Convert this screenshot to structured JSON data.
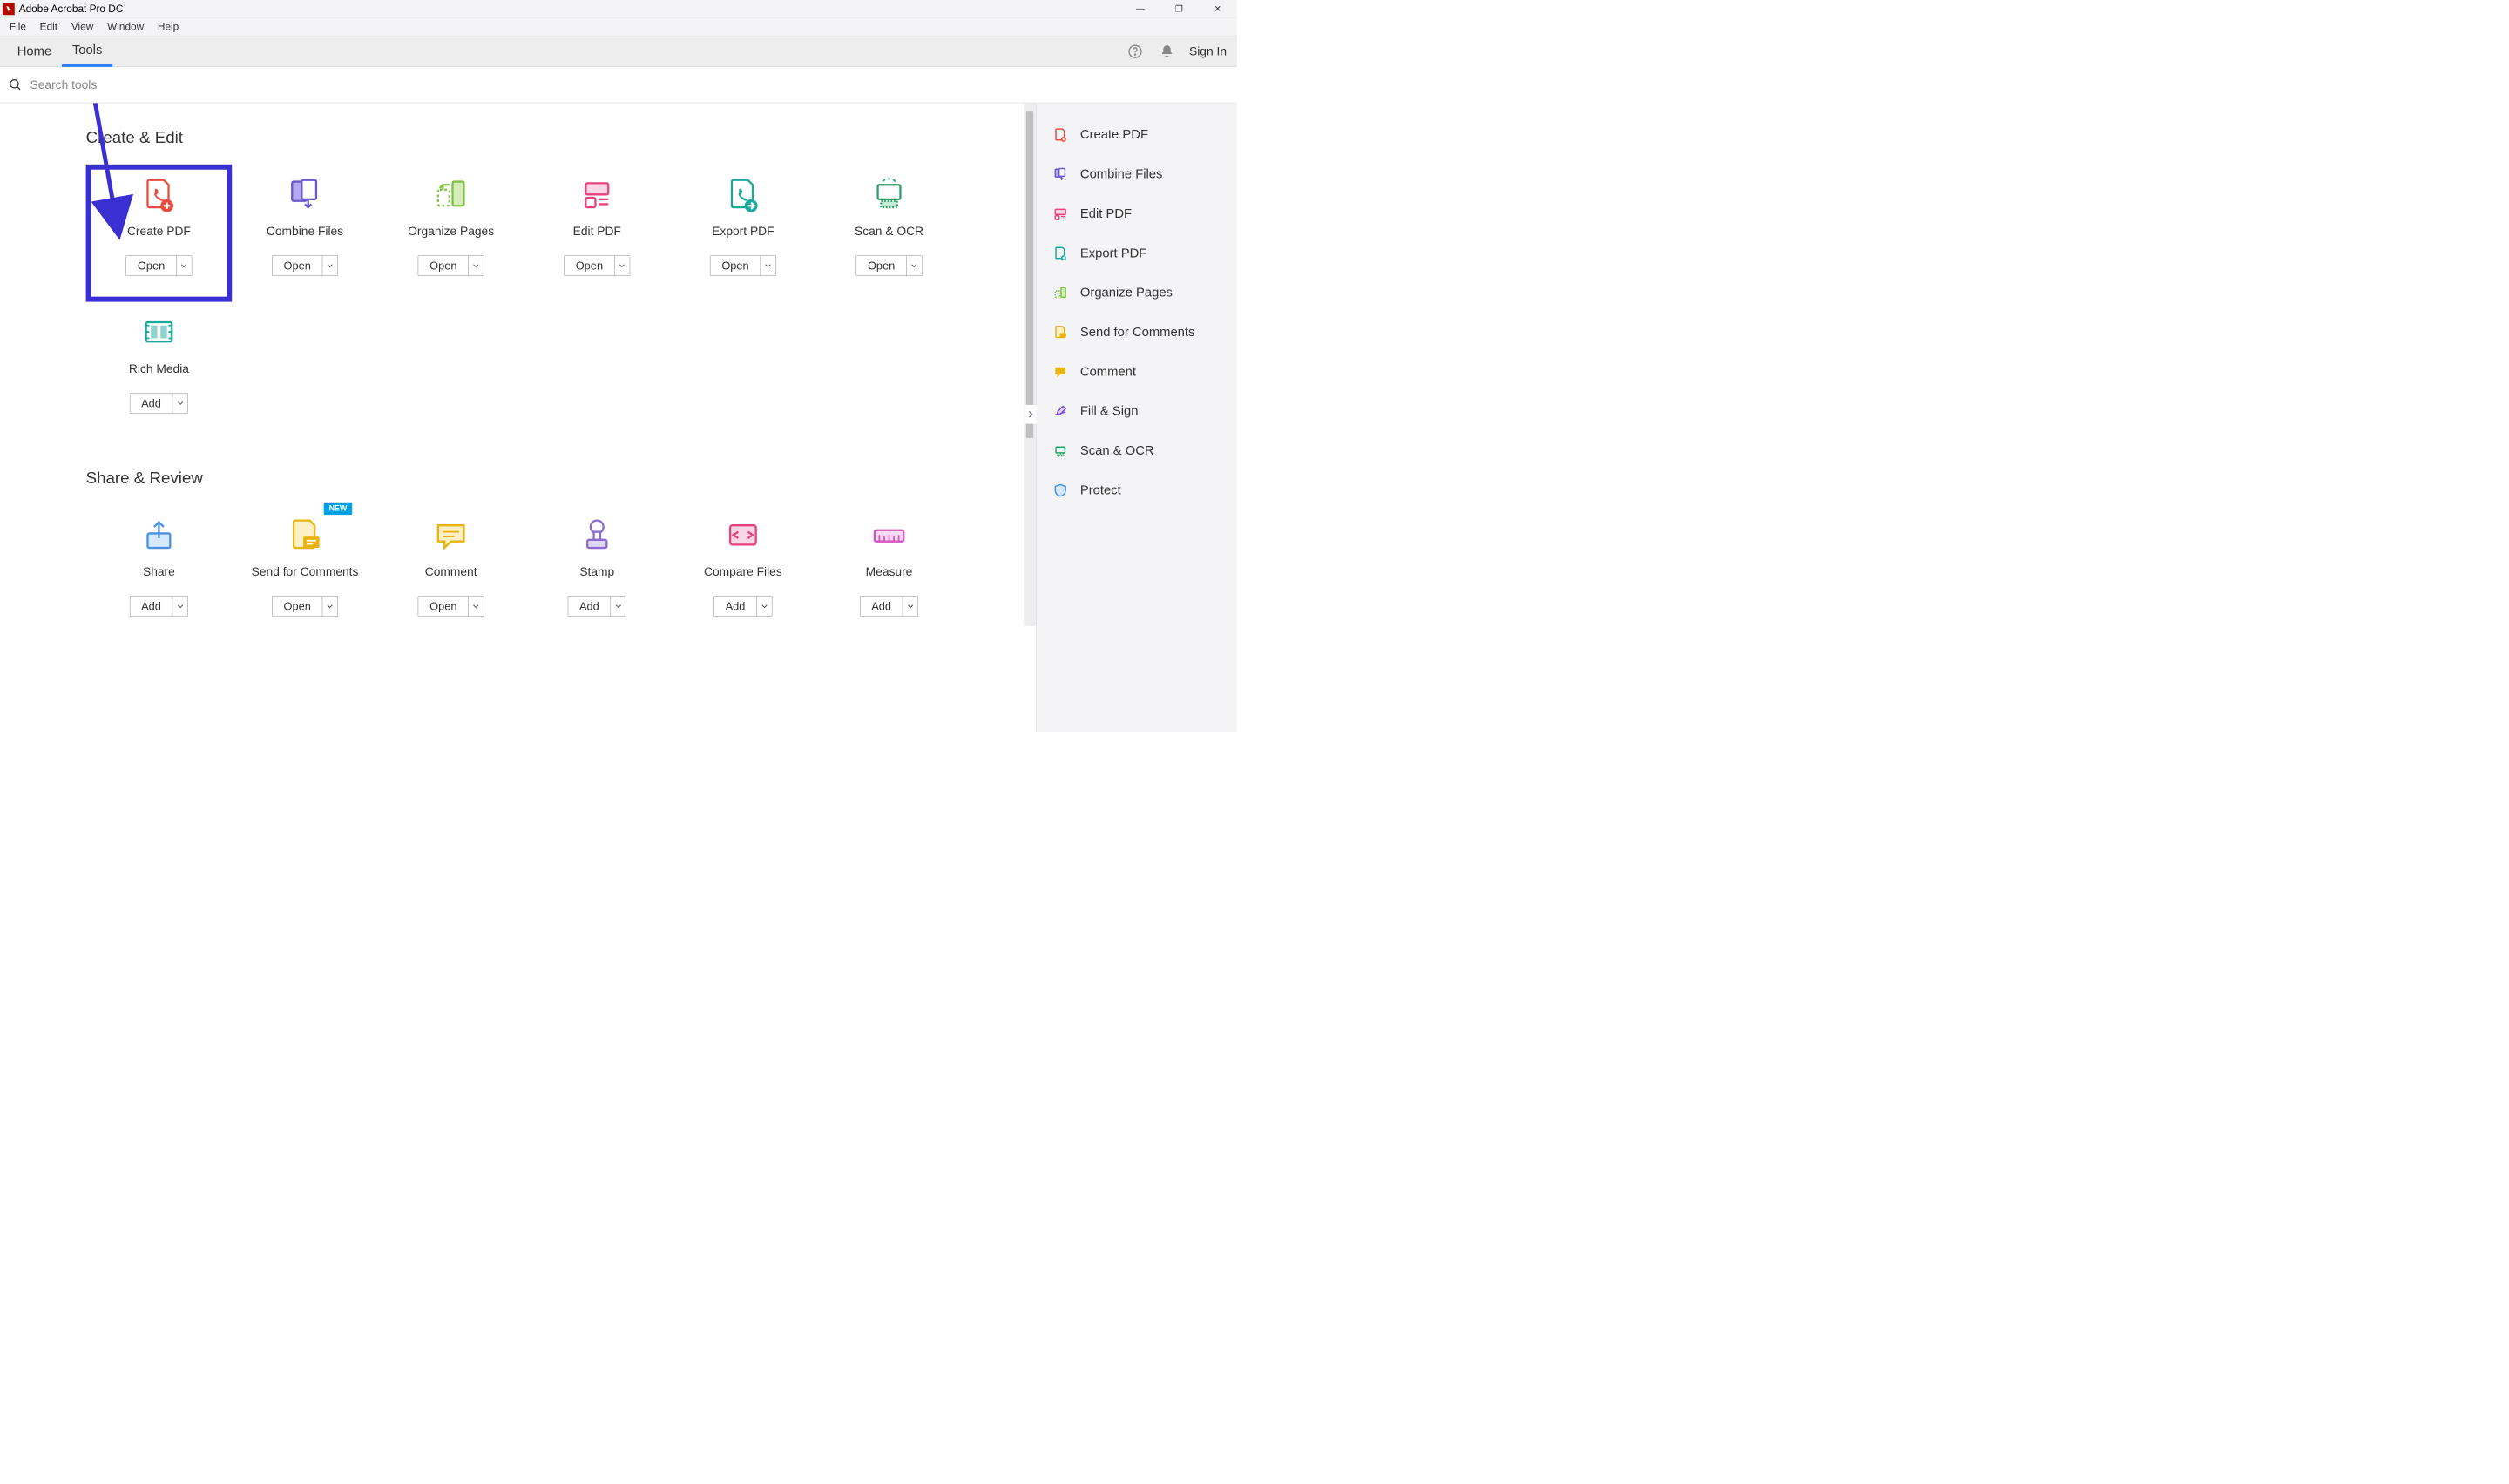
{
  "window": {
    "title": "Adobe Acrobat Pro DC",
    "minimize": "—",
    "maximize": "❐",
    "close": "✕"
  },
  "menubar": [
    "File",
    "Edit",
    "View",
    "Window",
    "Help"
  ],
  "tabbar": {
    "tabs": [
      "Home",
      "Tools"
    ],
    "active": 1,
    "signin": "Sign In"
  },
  "search": {
    "placeholder": "Search tools"
  },
  "sections": [
    {
      "title": "Create & Edit",
      "tools": [
        {
          "label": "Create PDF",
          "button": "Open",
          "icon": "create-pdf-icon",
          "highlighted": true
        },
        {
          "label": "Combine Files",
          "button": "Open",
          "icon": "combine-files-icon"
        },
        {
          "label": "Organize Pages",
          "button": "Open",
          "icon": "organize-pages-icon"
        },
        {
          "label": "Edit PDF",
          "button": "Open",
          "icon": "edit-pdf-icon"
        },
        {
          "label": "Export PDF",
          "button": "Open",
          "icon": "export-pdf-icon"
        },
        {
          "label": "Scan & OCR",
          "button": "Open",
          "icon": "scan-ocr-icon"
        },
        {
          "label": "Rich Media",
          "button": "Add",
          "icon": "rich-media-icon"
        }
      ]
    },
    {
      "title": "Share & Review",
      "tools": [
        {
          "label": "Share",
          "button": "Add",
          "icon": "share-icon"
        },
        {
          "label": "Send for Comments",
          "button": "Open",
          "icon": "send-comments-icon",
          "badge": "NEW"
        },
        {
          "label": "Comment",
          "button": "Open",
          "icon": "comment-icon"
        },
        {
          "label": "Stamp",
          "button": "Add",
          "icon": "stamp-icon"
        },
        {
          "label": "Compare Files",
          "button": "Add",
          "icon": "compare-files-icon"
        },
        {
          "label": "Measure",
          "button": "Add",
          "icon": "measure-icon"
        }
      ]
    }
  ],
  "right_panel": [
    {
      "label": "Create PDF",
      "icon": "create-pdf-icon",
      "color": "#e84c3d"
    },
    {
      "label": "Combine Files",
      "icon": "combine-files-icon",
      "color": "#6a5acd"
    },
    {
      "label": "Edit PDF",
      "icon": "edit-pdf-icon",
      "color": "#e8427d"
    },
    {
      "label": "Export PDF",
      "icon": "export-pdf-icon",
      "color": "#1aa99b"
    },
    {
      "label": "Organize Pages",
      "icon": "organize-pages-icon",
      "color": "#7fc241"
    },
    {
      "label": "Send for Comments",
      "icon": "send-comments-icon",
      "color": "#e7b411"
    },
    {
      "label": "Comment",
      "icon": "comment-icon",
      "color": "#e7b411"
    },
    {
      "label": "Fill & Sign",
      "icon": "fill-sign-icon",
      "color": "#7b4fd0"
    },
    {
      "label": "Scan & OCR",
      "icon": "scan-ocr-icon",
      "color": "#29a36a"
    },
    {
      "label": "Protect",
      "icon": "protect-icon",
      "color": "#4a90e2"
    }
  ]
}
